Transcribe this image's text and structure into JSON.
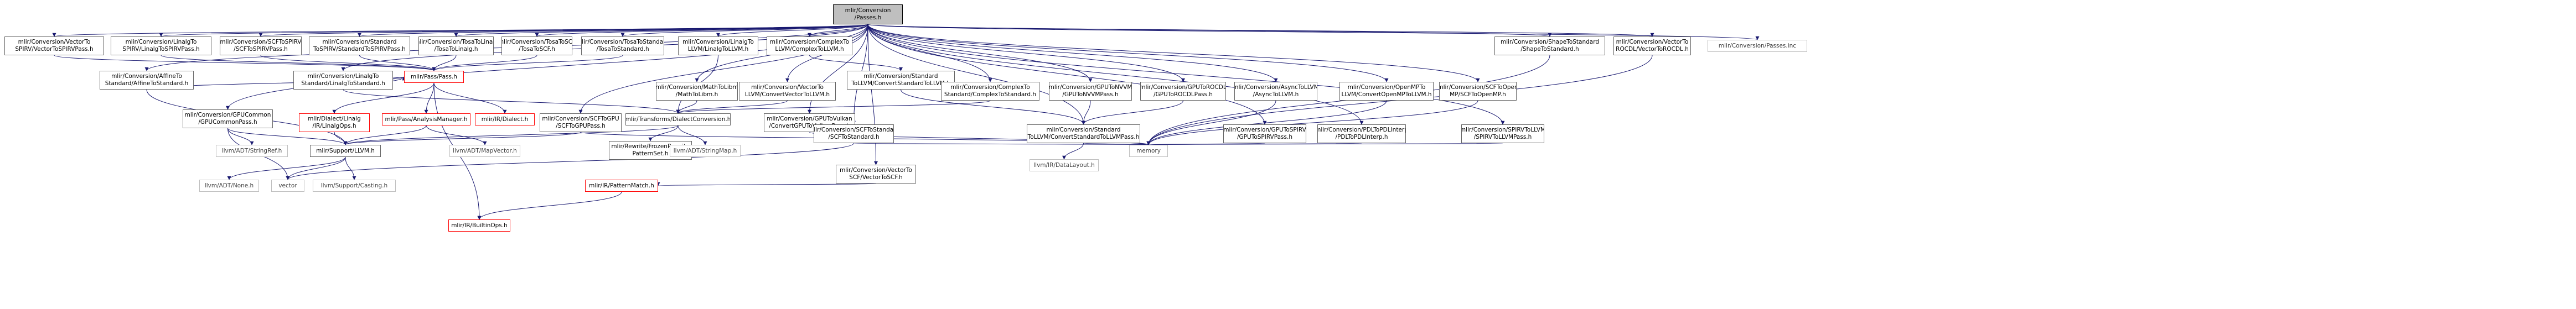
{
  "graph": {
    "root": "mlir/Conversion/Passes.h",
    "nodes": [
      {
        "id": "n0",
        "label": [
          "mlir/Conversion",
          "/Passes.h"
        ],
        "kind": "root"
      },
      {
        "id": "n1",
        "label": [
          "mlir/Conversion/VectorTo",
          "SPIRV/VectorToSPIRVPass.h"
        ],
        "kind": "link"
      },
      {
        "id": "n2",
        "label": [
          "mlir/Conversion/LinalgTo",
          "SPIRV/LinalgToSPIRVPass.h"
        ],
        "kind": "link"
      },
      {
        "id": "n3",
        "label": [
          "mlir/Conversion/SCFToSPIRV",
          "/SCFToSPIRVPass.h"
        ],
        "kind": "link"
      },
      {
        "id": "n4",
        "label": [
          "mlir/Conversion/Standard",
          "ToSPIRV/StandardToSPIRVPass.h"
        ],
        "kind": "link"
      },
      {
        "id": "n5",
        "label": [
          "mlir/Conversion/TosaToLinalg",
          "/TosaToLinalg.h"
        ],
        "kind": "link"
      },
      {
        "id": "n6",
        "label": [
          "mlir/Conversion/TosaToSCF",
          "/TosaToSCF.h"
        ],
        "kind": "link"
      },
      {
        "id": "n7",
        "label": [
          "mlir/Conversion/TosaToStandard",
          "/TosaToStandard.h"
        ],
        "kind": "link"
      },
      {
        "id": "n8",
        "label": [
          "mlir/Conversion/LinalgTo",
          "LLVM/LinalgToLLVM.h"
        ],
        "kind": "link"
      },
      {
        "id": "n9",
        "label": [
          "mlir/Conversion/ComplexTo",
          "LLVM/ComplexToLLVM.h"
        ],
        "kind": "link"
      },
      {
        "id": "n10",
        "label": [
          "mlir/Conversion/ShapeToStandard",
          "/ShapeToStandard.h"
        ],
        "kind": "link"
      },
      {
        "id": "n11",
        "label": [
          "mlir/Conversion/VectorTo",
          "ROCDL/VectorToROCDL.h"
        ],
        "kind": "link"
      },
      {
        "id": "n12",
        "label": [
          "mlir/Conversion/Passes.inc"
        ],
        "kind": "plain"
      },
      {
        "id": "n13",
        "label": [
          "mlir/Conversion/AffineTo",
          "Standard/AffineToStandard.h"
        ],
        "kind": "link"
      },
      {
        "id": "n14",
        "label": [
          "mlir/Conversion/LinalgTo",
          "Standard/LinalgToStandard.h"
        ],
        "kind": "link"
      },
      {
        "id": "n15",
        "label": [
          "mlir/Pass/Pass.h"
        ],
        "kind": "red"
      },
      {
        "id": "n16",
        "label": [
          "mlir/Conversion/MathToLibm",
          "/MathToLibm.h"
        ],
        "kind": "link"
      },
      {
        "id": "n17",
        "label": [
          "mlir/Conversion/VectorTo",
          "LLVM/ConvertVectorToLLVM.h"
        ],
        "kind": "link"
      },
      {
        "id": "n18",
        "label": [
          "mlir/Conversion/Standard",
          "ToLLVM/ConvertStandardToLLVM.h"
        ],
        "kind": "link"
      },
      {
        "id": "n19",
        "label": [
          "mlir/Conversion/ComplexTo",
          "Standard/ComplexToStandard.h"
        ],
        "kind": "link"
      },
      {
        "id": "n20",
        "label": [
          "mlir/Conversion/GPUToNVVM",
          "/GPUToNVVMPass.h"
        ],
        "kind": "link"
      },
      {
        "id": "n21",
        "label": [
          "mlir/Conversion/GPUToROCDL",
          "/GPUToROCDLPass.h"
        ],
        "kind": "link"
      },
      {
        "id": "n22",
        "label": [
          "mlir/Conversion/AsyncToLLVM",
          "/AsyncToLLVM.h"
        ],
        "kind": "link"
      },
      {
        "id": "n23",
        "label": [
          "mlir/Conversion/OpenMPTo",
          "LLVM/ConvertOpenMPToLLVM.h"
        ],
        "kind": "link"
      },
      {
        "id": "n24",
        "label": [
          "mlir/Conversion/SCFToOpen",
          "MP/SCFToOpenMP.h"
        ],
        "kind": "link"
      },
      {
        "id": "n25",
        "label": [
          "mlir/Conversion/GPUCommon",
          "/GPUCommonPass.h"
        ],
        "kind": "link"
      },
      {
        "id": "n26",
        "label": [
          "mlir/Dialect/Linalg",
          "/IR/LinalgOps.h"
        ],
        "kind": "red"
      },
      {
        "id": "n27",
        "label": [
          "mlir/Pass/AnalysisManager.h"
        ],
        "kind": "red"
      },
      {
        "id": "n28",
        "label": [
          "mlir/IR/Dialect.h"
        ],
        "kind": "red"
      },
      {
        "id": "n29",
        "label": [
          "mlir/Conversion/SCFToGPU",
          "/SCFToGPUPass.h"
        ],
        "kind": "link"
      },
      {
        "id": "n30",
        "label": [
          "mlir/Transforms/DialectConversion.h"
        ],
        "kind": "link"
      },
      {
        "id": "n31",
        "label": [
          "mlir/Conversion/GPUToVulkan",
          "/ConvertGPUToVulkanPass.h"
        ],
        "kind": "link"
      },
      {
        "id": "n32",
        "label": [
          "mlir/Conversion/SCFToStandard",
          "/SCFToStandard.h"
        ],
        "kind": "link"
      },
      {
        "id": "n33",
        "label": [
          "mlir/Conversion/Standard",
          "ToLLVM/ConvertStandardToLLVMPass.h"
        ],
        "kind": "link"
      },
      {
        "id": "n34",
        "label": [
          "mlir/Conversion/GPUToSPIRV",
          "/GPUToSPIRVPass.h"
        ],
        "kind": "link"
      },
      {
        "id": "n35",
        "label": [
          "mlir/Conversion/PDLToPDLInterp",
          "/PDLToPDLInterp.h"
        ],
        "kind": "link"
      },
      {
        "id": "n36",
        "label": [
          "mlir/Conversion/SPIRVToLLVM",
          "/SPIRVToLLVMPass.h"
        ],
        "kind": "link"
      },
      {
        "id": "n37",
        "label": [
          "llvm/ADT/StringRef.h"
        ],
        "kind": "gray"
      },
      {
        "id": "n38",
        "label": [
          "mlir/Support/LLVM.h"
        ],
        "kind": "link"
      },
      {
        "id": "n39",
        "label": [
          "llvm/ADT/MapVector.h"
        ],
        "kind": "gray"
      },
      {
        "id": "n40",
        "label": [
          "mlir/Rewrite/FrozenRewrite",
          "PatternSet.h"
        ],
        "kind": "link"
      },
      {
        "id": "n41",
        "label": [
          "llvm/ADT/StringMap.h"
        ],
        "kind": "gray"
      },
      {
        "id": "n42",
        "label": [
          "llvm/IR/DataLayout.h"
        ],
        "kind": "gray"
      },
      {
        "id": "n43",
        "label": [
          "memory"
        ],
        "kind": "gray"
      },
      {
        "id": "n44",
        "label": [
          "mlir/Conversion/VectorTo",
          "SCF/VectorToSCF.h"
        ],
        "kind": "link"
      },
      {
        "id": "n45",
        "label": [
          "llvm/ADT/None.h"
        ],
        "kind": "gray"
      },
      {
        "id": "n46",
        "label": [
          "vector"
        ],
        "kind": "gray"
      },
      {
        "id": "n47",
        "label": [
          "llvm/Support/Casting.h"
        ],
        "kind": "gray"
      },
      {
        "id": "n48",
        "label": [
          "mlir/IR/PatternMatch.h"
        ],
        "kind": "red"
      },
      {
        "id": "n49",
        "label": [
          "mlir/IR/BuiltinOps.h"
        ],
        "kind": "red"
      }
    ],
    "edges": [
      [
        "n0",
        "n1"
      ],
      [
        "n0",
        "n2"
      ],
      [
        "n0",
        "n3"
      ],
      [
        "n0",
        "n4"
      ],
      [
        "n0",
        "n5"
      ],
      [
        "n0",
        "n6"
      ],
      [
        "n0",
        "n7"
      ],
      [
        "n0",
        "n8"
      ],
      [
        "n0",
        "n9"
      ],
      [
        "n0",
        "n10"
      ],
      [
        "n0",
        "n11"
      ],
      [
        "n0",
        "n12"
      ],
      [
        "n0",
        "n13"
      ],
      [
        "n0",
        "n14"
      ],
      [
        "n0",
        "n16"
      ],
      [
        "n0",
        "n17"
      ],
      [
        "n0",
        "n19"
      ],
      [
        "n0",
        "n20"
      ],
      [
        "n0",
        "n21"
      ],
      [
        "n0",
        "n22"
      ],
      [
        "n0",
        "n23"
      ],
      [
        "n0",
        "n24"
      ],
      [
        "n0",
        "n25"
      ],
      [
        "n0",
        "n29"
      ],
      [
        "n0",
        "n31"
      ],
      [
        "n0",
        "n32"
      ],
      [
        "n0",
        "n33"
      ],
      [
        "n0",
        "n34"
      ],
      [
        "n0",
        "n35"
      ],
      [
        "n0",
        "n36"
      ],
      [
        "n0",
        "n44"
      ],
      [
        "n1",
        "n15"
      ],
      [
        "n2",
        "n15"
      ],
      [
        "n3",
        "n15"
      ],
      [
        "n4",
        "n15"
      ],
      [
        "n5",
        "n15"
      ],
      [
        "n6",
        "n15"
      ],
      [
        "n7",
        "n15"
      ],
      [
        "n13",
        "n15"
      ],
      [
        "n14",
        "n15"
      ],
      [
        "n8",
        "n30"
      ],
      [
        "n9",
        "n18"
      ],
      [
        "n16",
        "n30"
      ],
      [
        "n17",
        "n30"
      ],
      [
        "n18",
        "n33"
      ],
      [
        "n19",
        "n30"
      ],
      [
        "n20",
        "n33"
      ],
      [
        "n21",
        "n33"
      ],
      [
        "n22",
        "n43"
      ],
      [
        "n23",
        "n43"
      ],
      [
        "n24",
        "n43"
      ],
      [
        "n10",
        "n43"
      ],
      [
        "n11",
        "n43"
      ],
      [
        "n13",
        "n38"
      ],
      [
        "n14",
        "n30"
      ],
      [
        "n15",
        "n26"
      ],
      [
        "n15",
        "n27"
      ],
      [
        "n15",
        "n28"
      ],
      [
        "n15",
        "n49"
      ],
      [
        "n26",
        "n38"
      ],
      [
        "n27",
        "n38"
      ],
      [
        "n27",
        "n39"
      ],
      [
        "n25",
        "n37"
      ],
      [
        "n25",
        "n38"
      ],
      [
        "n25",
        "n46"
      ],
      [
        "n29",
        "n38"
      ],
      [
        "n29",
        "n43"
      ],
      [
        "n30",
        "n38"
      ],
      [
        "n30",
        "n40"
      ],
      [
        "n30",
        "n41"
      ],
      [
        "n31",
        "n43"
      ],
      [
        "n32",
        "n43"
      ],
      [
        "n32",
        "n46"
      ],
      [
        "n33",
        "n42"
      ],
      [
        "n33",
        "n43"
      ],
      [
        "n34",
        "n43"
      ],
      [
        "n35",
        "n43"
      ],
      [
        "n36",
        "n43"
      ],
      [
        "n38",
        "n45"
      ],
      [
        "n38",
        "n46"
      ],
      [
        "n38",
        "n47"
      ],
      [
        "n44",
        "n48"
      ],
      [
        "n48",
        "n49"
      ]
    ]
  },
  "colors": {
    "root_fill": "#bfbfbf",
    "edge": "#191970",
    "border": "#666666",
    "missing_border": "#ff0000",
    "external_border": "#bfbfbf"
  }
}
